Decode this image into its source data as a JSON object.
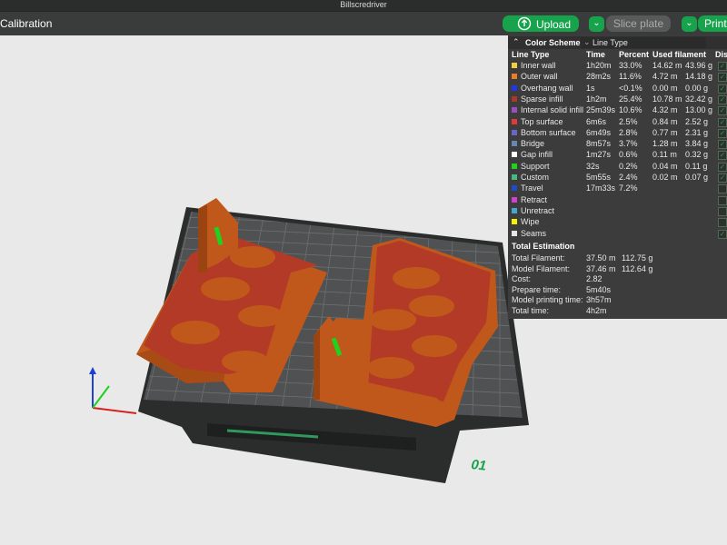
{
  "window": {
    "title": "Billscredriver"
  },
  "toolbar": {
    "tab_label": "Calibration",
    "upload_label": "Upload",
    "slice_label": "Slice plate",
    "print_label": "Print",
    "upload_icon": "upload-icon",
    "dropdown_icon": "chevron-down-icon"
  },
  "plate": {
    "number_label": "01"
  },
  "panel": {
    "header": {
      "label": "Color Scheme",
      "selected_scheme": "Line Type"
    },
    "columns": {
      "line_type": "Line Type",
      "time": "Time",
      "percent": "Percent",
      "used_filament": "Used filament",
      "display": "Dis"
    },
    "rows": [
      {
        "name": "Inner wall",
        "time": "1h20m",
        "percent": "33.0%",
        "length": "14.62 m",
        "weight": "43.96 g",
        "color": "#f1d040",
        "checked": true
      },
      {
        "name": "Outer wall",
        "time": "28m2s",
        "percent": "11.6%",
        "length": "4.72 m",
        "weight": "14.18 g",
        "color": "#f07b22",
        "checked": true
      },
      {
        "name": "Overhang wall",
        "time": "1s",
        "percent": "<0.1%",
        "length": "0.00 m",
        "weight": "0.00 g",
        "color": "#2137e6",
        "checked": true
      },
      {
        "name": "Sparse infill",
        "time": "1h2m",
        "percent": "25.4%",
        "length": "10.78 m",
        "weight": "32.42 g",
        "color": "#a8372e",
        "checked": true
      },
      {
        "name": "Internal solid infill",
        "time": "25m39s",
        "percent": "10.6%",
        "length": "4.32 m",
        "weight": "13.00 g",
        "color": "#9b4ec0",
        "checked": true
      },
      {
        "name": "Top surface",
        "time": "6m6s",
        "percent": "2.5%",
        "length": "0.84 m",
        "weight": "2.52 g",
        "color": "#e2393d",
        "checked": true
      },
      {
        "name": "Bottom surface",
        "time": "6m49s",
        "percent": "2.8%",
        "length": "0.77 m",
        "weight": "2.31 g",
        "color": "#6c63c8",
        "checked": true
      },
      {
        "name": "Bridge",
        "time": "8m57s",
        "percent": "3.7%",
        "length": "1.28 m",
        "weight": "3.84 g",
        "color": "#6487b8",
        "checked": true
      },
      {
        "name": "Gap infill",
        "time": "1m27s",
        "percent": "0.6%",
        "length": "0.11 m",
        "weight": "0.32 g",
        "color": "#ffffff",
        "checked": true
      },
      {
        "name": "Support",
        "time": "32s",
        "percent": "0.2%",
        "length": "0.04 m",
        "weight": "0.11 g",
        "color": "#1ed21e",
        "checked": true
      },
      {
        "name": "Custom",
        "time": "5m55s",
        "percent": "2.4%",
        "length": "0.02 m",
        "weight": "0.07 g",
        "color": "#49b982",
        "checked": true
      },
      {
        "name": "Travel",
        "time": "17m33s",
        "percent": "7.2%",
        "length": "",
        "weight": "",
        "color": "#2348c8",
        "checked": false
      },
      {
        "name": "Retract",
        "time": "",
        "percent": "",
        "length": "",
        "weight": "",
        "color": "#d43ed0",
        "checked": false
      },
      {
        "name": "Unretract",
        "time": "",
        "percent": "",
        "length": "",
        "weight": "",
        "color": "#47a6d0",
        "checked": false
      },
      {
        "name": "Wipe",
        "time": "",
        "percent": "",
        "length": "",
        "weight": "",
        "color": "#f4f200",
        "checked": false
      },
      {
        "name": "Seams",
        "time": "",
        "percent": "",
        "length": "",
        "weight": "",
        "color": "#e6e6e6",
        "checked": true
      }
    ],
    "estimation": {
      "title": "Total Estimation",
      "items": [
        {
          "label": "Total Filament:",
          "value": "37.50 m",
          "value2": "112.75 g"
        },
        {
          "label": "Model Filament:",
          "value": "37.46 m",
          "value2": "112.64 g"
        },
        {
          "label": "Cost:",
          "value": "2.82",
          "value2": ""
        },
        {
          "label": "Prepare time:",
          "value": "5m40s",
          "value2": ""
        },
        {
          "label": "Model printing time:",
          "value": "3h57m",
          "value2": ""
        },
        {
          "label": "Total time:",
          "value": "4h2m",
          "value2": ""
        }
      ]
    }
  }
}
